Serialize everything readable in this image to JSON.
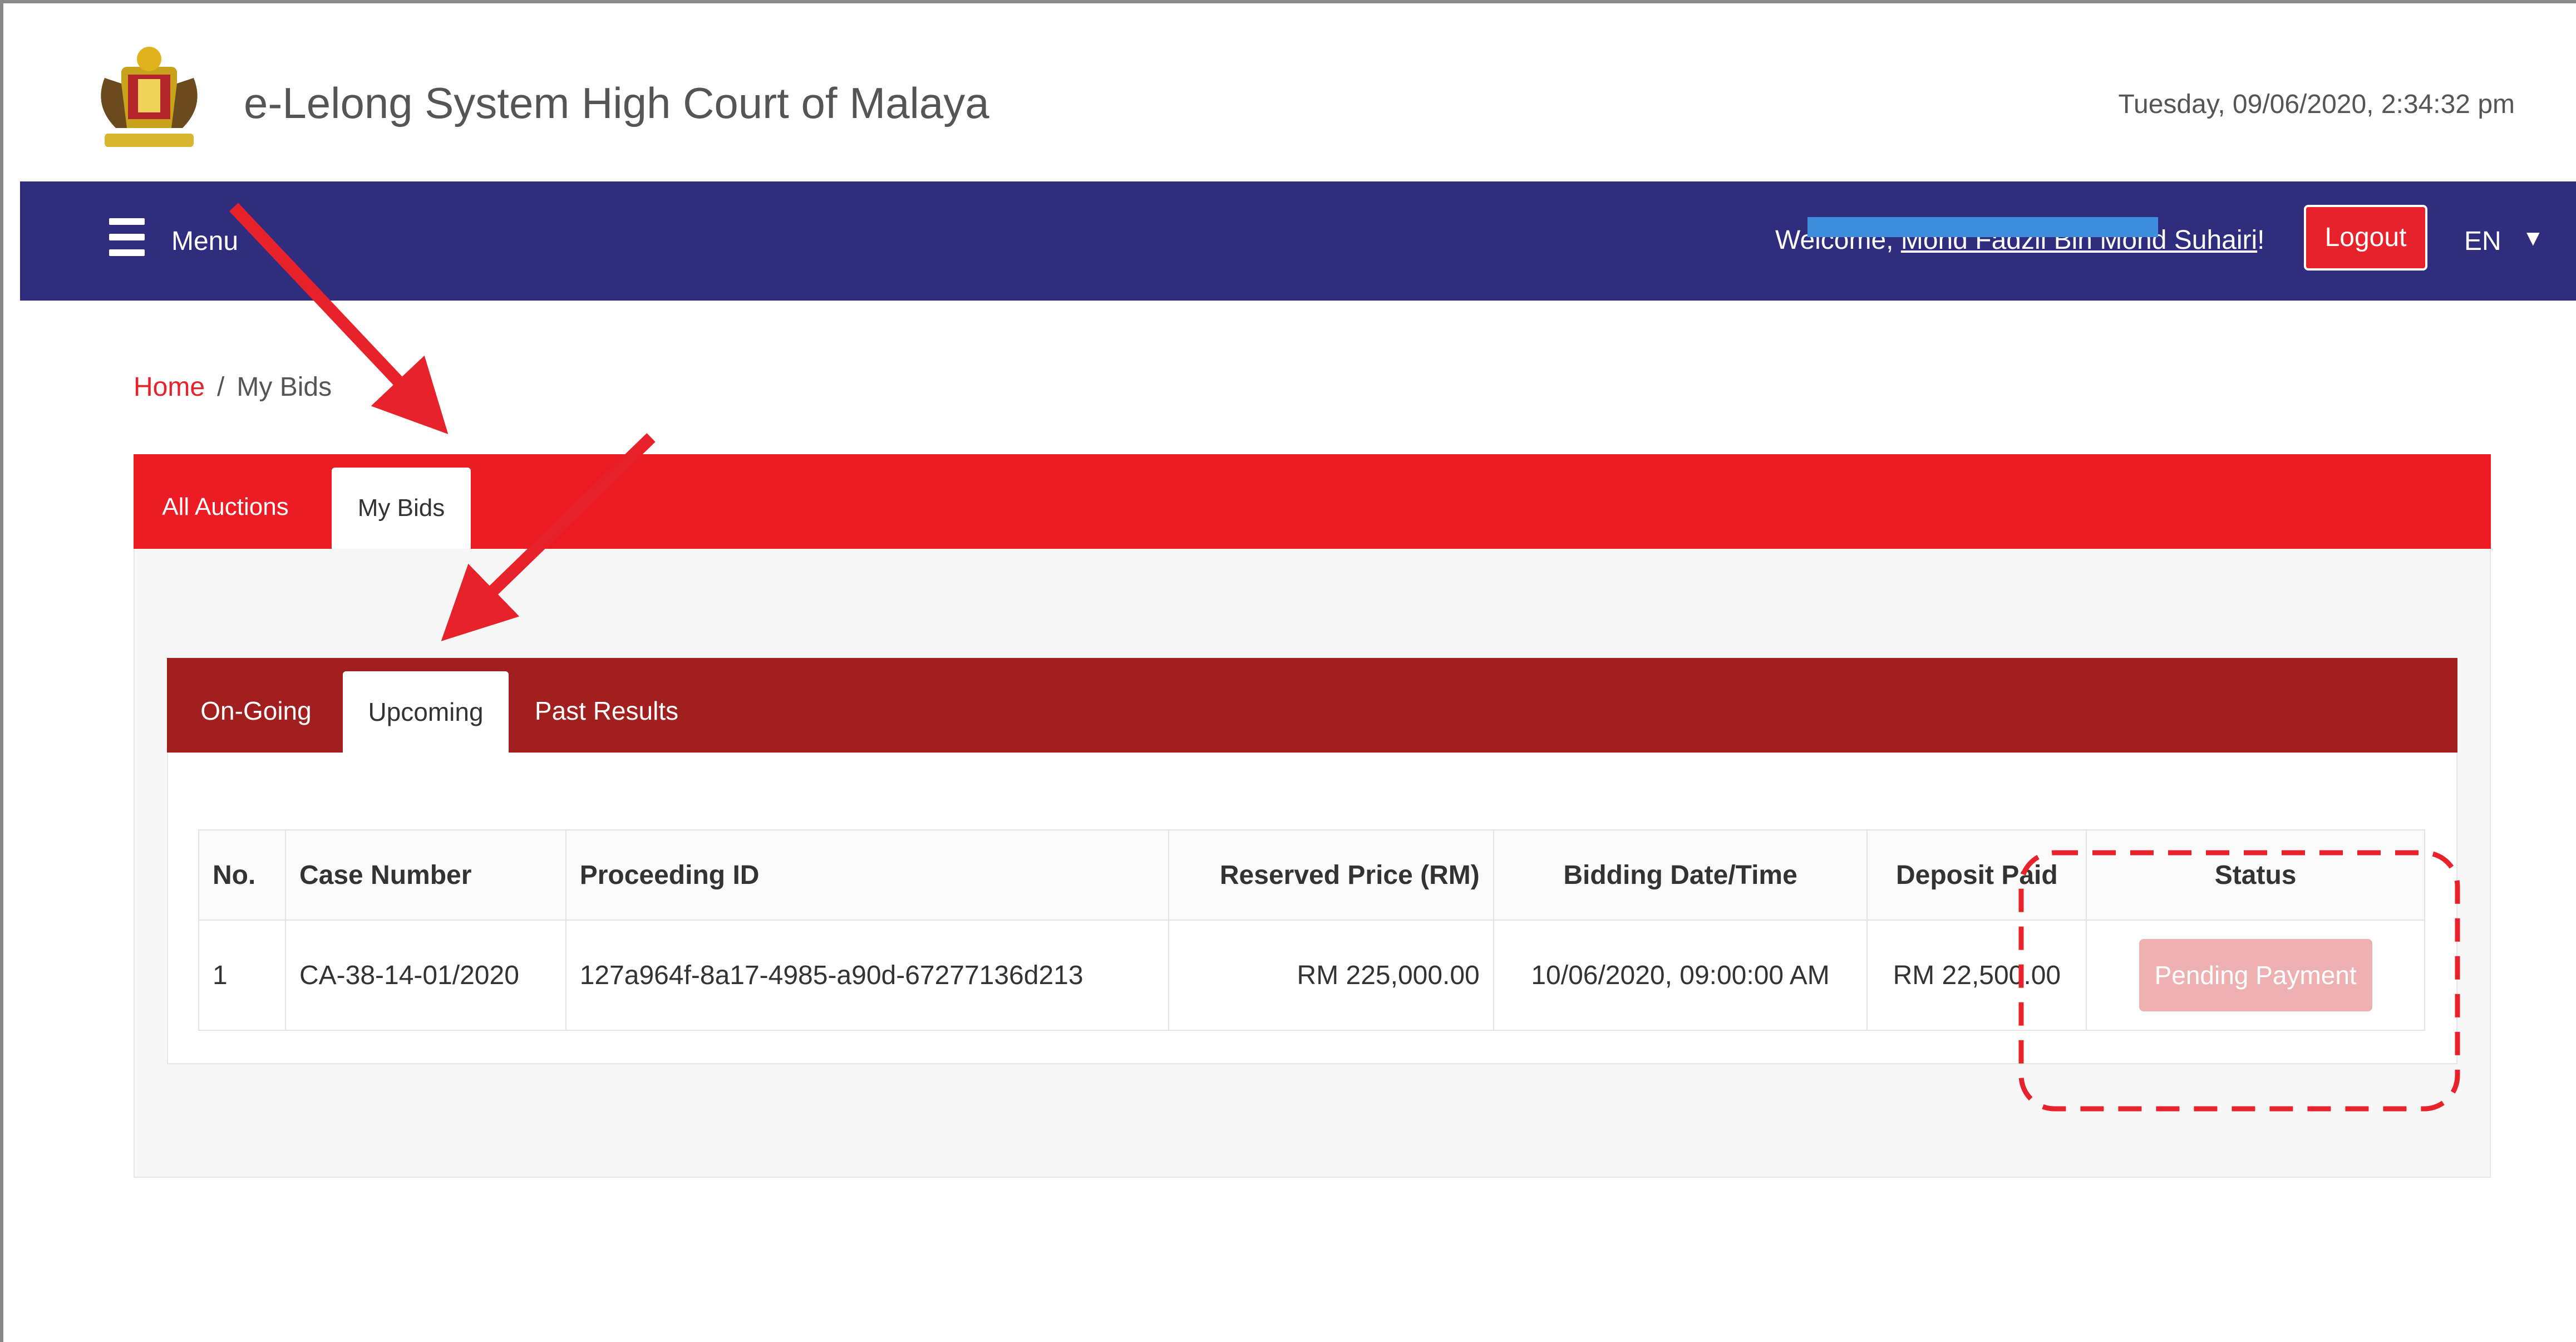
{
  "header": {
    "app_title": "e-Lelong System High Court of Malaya",
    "datetime": "Tuesday, 09/06/2020, 2:34:32 pm"
  },
  "navbar": {
    "menu_label": "Menu",
    "welcome_prefix": "Welcome, ",
    "user_name": "Mohd Fadzil Bin Mohd Suhairi",
    "welcome_suffix": "!",
    "logout_label": "Logout",
    "language": "EN"
  },
  "breadcrumb": {
    "home": "Home",
    "separator": "/",
    "current": "My Bids"
  },
  "outer_tabs": [
    {
      "label": "All Auctions",
      "active": false
    },
    {
      "label": "My Bids",
      "active": true
    }
  ],
  "inner_tabs": [
    {
      "label": "On-Going",
      "active": false
    },
    {
      "label": "Upcoming",
      "active": true
    },
    {
      "label": "Past Results",
      "active": false
    }
  ],
  "table": {
    "columns": [
      "No.",
      "Case Number",
      "Proceeding ID",
      "Reserved Price (RM)",
      "Bidding Date/Time",
      "Deposit Paid",
      "Status"
    ],
    "rows": [
      {
        "no": "1",
        "case_number": "CA-38-14-01/2020",
        "proceeding_id": "127a964f-8a17-4985-a90d-67277136d213",
        "reserved_price": "RM 225,000.00",
        "bidding_datetime": "10/06/2020, 09:00:00 AM",
        "deposit_paid": "RM 22,500.00",
        "status": "Pending Payment"
      }
    ]
  },
  "colors": {
    "navbar": "#302d7f",
    "outer_tab_bar": "#ed1c24",
    "inner_tab_bar": "#a21f1f",
    "logout_button": "#e8222a",
    "status_pending": "#efb0b2",
    "annotation": "#e8222a"
  }
}
